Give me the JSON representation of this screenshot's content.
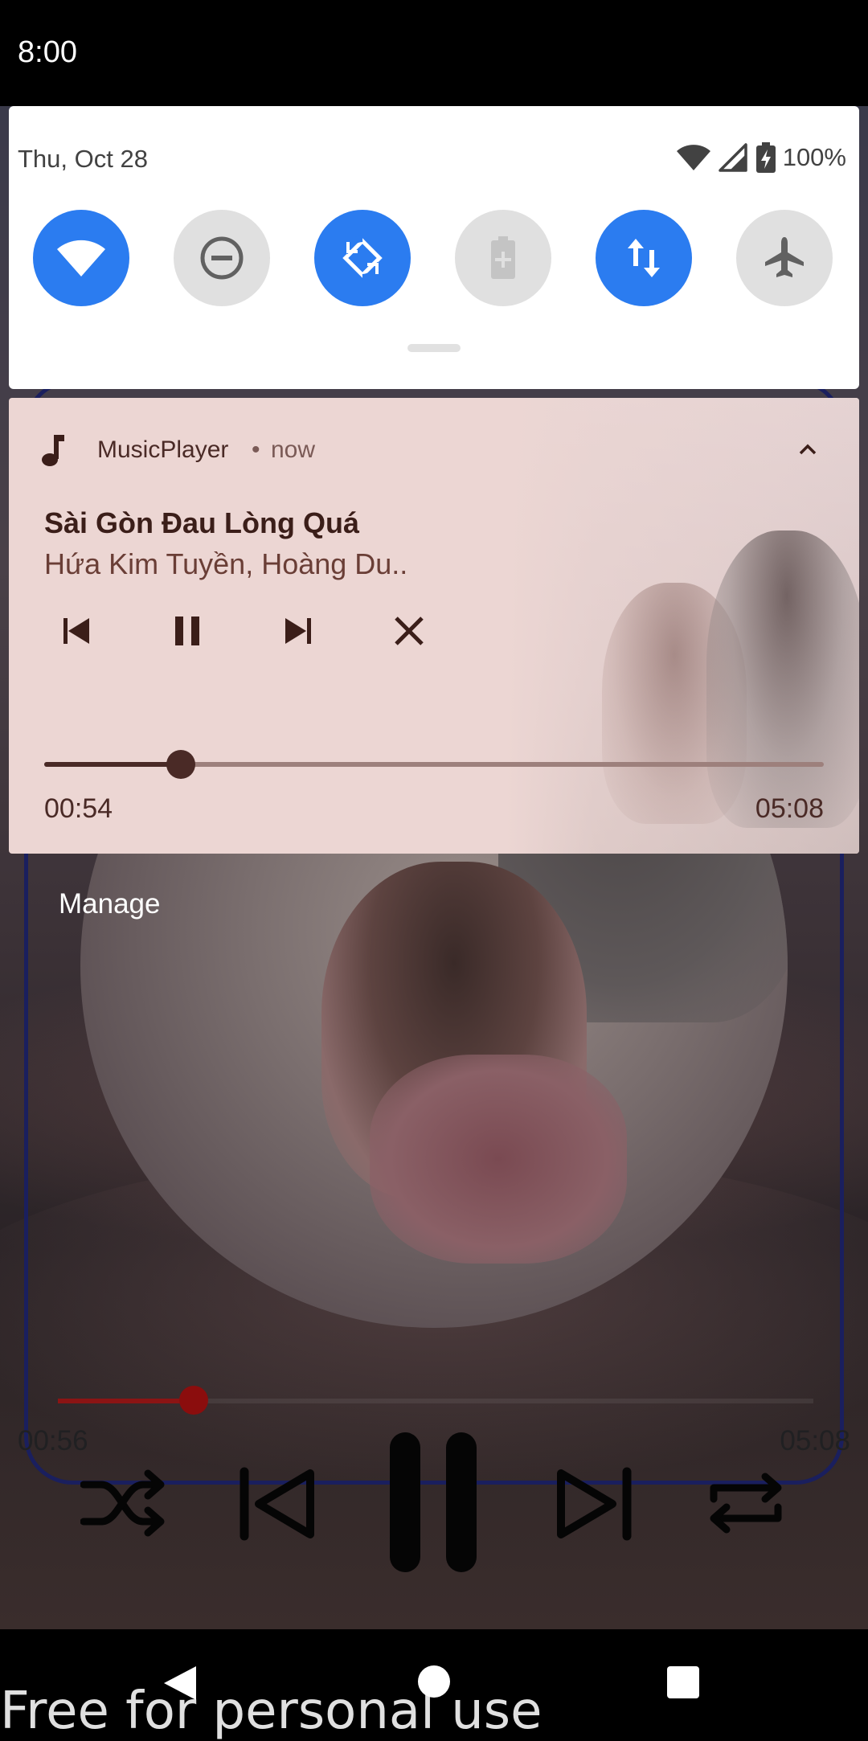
{
  "status_bar": {
    "time": "8:00"
  },
  "quick_settings": {
    "date": "Thu, Oct 28",
    "battery_percent": "100%",
    "tiles": [
      {
        "name": "wifi",
        "state": "on"
      },
      {
        "name": "do-not-disturb",
        "state": "off"
      },
      {
        "name": "auto-rotate",
        "state": "on"
      },
      {
        "name": "battery-saver",
        "state": "disabled"
      },
      {
        "name": "mobile-data",
        "state": "on"
      },
      {
        "name": "airplane-mode",
        "state": "off"
      }
    ]
  },
  "notification": {
    "app_name": "MusicPlayer",
    "separator": "•",
    "time": "now",
    "title": "Sài Gòn Đau Lòng Quá",
    "artist": "Hứa Kim Tuyền, Hoàng Du..",
    "elapsed": "00:54",
    "duration": "05:08",
    "progress": 0.175,
    "controls": [
      "previous",
      "pause",
      "next",
      "close"
    ]
  },
  "manage_label": "Manage",
  "player": {
    "elapsed": "00:56",
    "duration": "05:08",
    "progress": 0.18,
    "controls": [
      "shuffle",
      "previous",
      "pause",
      "next",
      "repeat"
    ]
  },
  "watermark": "Free for personal use",
  "colors": {
    "tile_on": "#2b7cf0",
    "tile_off": "#e0e0e0",
    "notification_bg": "#ecd6d3",
    "notification_text": "#3b1e19",
    "player_progress": "#8b1414"
  }
}
